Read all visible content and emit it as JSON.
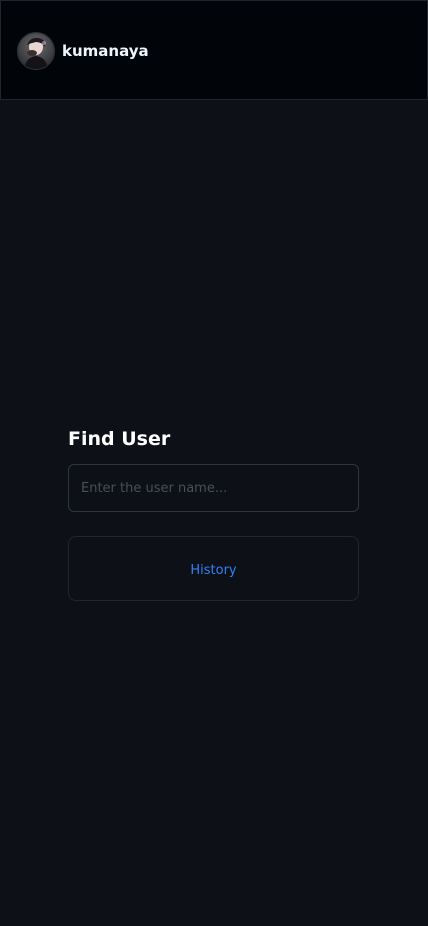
{
  "header": {
    "username": "kumanaya"
  },
  "main": {
    "title": "Find User",
    "search": {
      "placeholder": "Enter the user name...",
      "value": ""
    },
    "history_button_label": "History"
  },
  "colors": {
    "background": "#0d1117",
    "header_background": "#010409",
    "accent": "#2f81f7",
    "border": "#30363d"
  },
  "icons": {
    "avatar": "user-avatar-photo"
  }
}
